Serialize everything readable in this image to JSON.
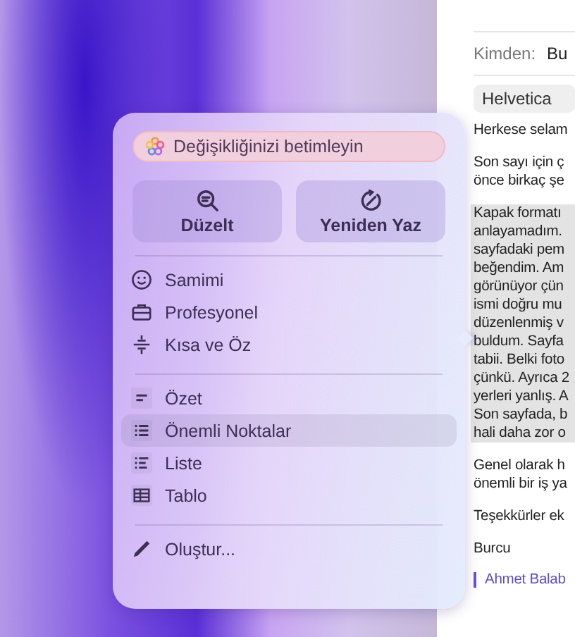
{
  "mail": {
    "from_label": "Kimden:",
    "from_value": "Bu",
    "font": "Helvetica",
    "paragraphs": [
      {
        "lines": [
          "Herkese selam"
        ],
        "highlighted": false
      },
      {
        "lines": [
          "Son sayı için ç",
          "önce birkaç şe"
        ],
        "highlighted": false
      },
      {
        "lines": [
          "Kapak formatı",
          "anlayamadım.",
          "sayfadaki pem",
          "beğendim. Am",
          "görünüyor çün",
          "ismi doğru mu",
          "düzenlenmiş v",
          "buldum. Sayfa",
          "tabii. Belki foto",
          "çünkü. Ayrıca 2",
          "yerleri yanlış. A",
          "Son sayfada, b",
          "hali daha zor o"
        ],
        "highlighted": true
      },
      {
        "lines": [
          "Genel olarak h",
          "önemli bir iş ya"
        ],
        "highlighted": false
      },
      {
        "lines": [
          "Teşekkürler ek"
        ],
        "highlighted": false
      },
      {
        "lines": [
          "Burcu"
        ],
        "highlighted": false
      }
    ],
    "quote": "Ahmet Balab"
  },
  "popover": {
    "prompt_placeholder": "Değişikliğinizi betimleyin",
    "actions": [
      {
        "label": "Düzelt"
      },
      {
        "label": "Yeniden Yaz"
      }
    ],
    "groups": [
      [
        {
          "label": "Samimi",
          "selected": false
        },
        {
          "label": "Profesyonel",
          "selected": false
        },
        {
          "label": "Kısa ve Öz",
          "selected": false
        }
      ],
      [
        {
          "label": "Özet",
          "selected": false
        },
        {
          "label": "Önemli Noktalar",
          "selected": true
        },
        {
          "label": "Liste",
          "selected": false
        },
        {
          "label": "Tablo",
          "selected": false
        }
      ],
      [
        {
          "label": "Oluştur...",
          "selected": false
        }
      ]
    ]
  }
}
